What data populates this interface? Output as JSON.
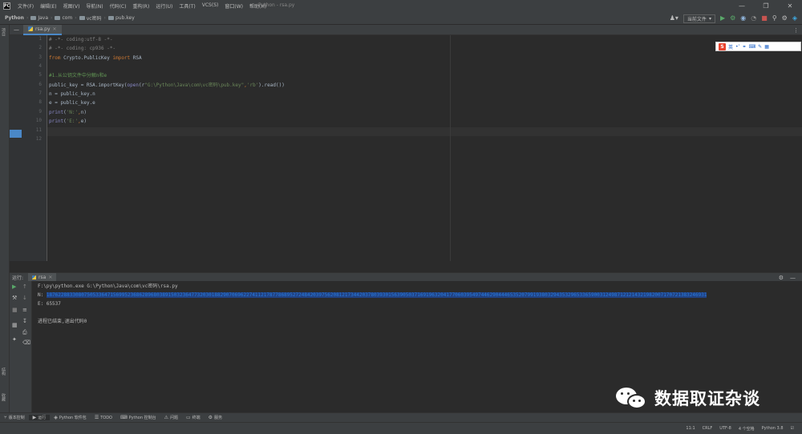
{
  "menu": {
    "logo": "PC",
    "items": [
      "文件(F)",
      "编辑(E)",
      "视图(V)",
      "导航(N)",
      "代码(C)",
      "重构(R)",
      "运行(U)",
      "工具(T)",
      "VCS(S)",
      "窗口(W)",
      "帮助(H)"
    ],
    "window_title": "Python - rsa.py"
  },
  "navbar": {
    "breadcrumbs": [
      "Python",
      "Java",
      "com",
      "vc密码",
      "pub.key"
    ],
    "run_config": "当前文件"
  },
  "left_strip": {
    "tabs": [
      "项目",
      "结构",
      "收藏"
    ]
  },
  "editor": {
    "tab_label": "rsa.py",
    "line_numbers": [
      "1",
      "2",
      "3",
      "4",
      "5",
      "6",
      "7",
      "8",
      "9",
      "10",
      "11",
      "12"
    ],
    "lines": [
      [
        {
          "t": "# -*- coding:utf-8 -*-",
          "c": "c-comment"
        }
      ],
      [
        {
          "t": "# -*- coding: cp936 -*-",
          "c": "c-comment"
        }
      ],
      [
        {
          "t": "from ",
          "c": "c-kw"
        },
        {
          "t": "Crypto.PublicKey ",
          "c": ""
        },
        {
          "t": "import ",
          "c": "c-kw"
        },
        {
          "t": "RSA",
          "c": ""
        }
      ],
      [],
      [
        {
          "t": "#1.从公钥文件中分解n和e",
          "c": "c-comment-cn"
        }
      ],
      [
        {
          "t": "public_key = RSA.importKey(",
          "c": ""
        },
        {
          "t": "open",
          "c": "c-builtin"
        },
        {
          "t": "(r",
          "c": ""
        },
        {
          "t": "\"G:\\Python\\Java\\com\\vc密码\\pub.key\"",
          "c": "c-str"
        },
        {
          "t": ",",
          "c": "c-kw"
        },
        {
          "t": "'rb'",
          "c": "c-str"
        },
        {
          "t": ").read())",
          "c": ""
        }
      ],
      [
        {
          "t": "n = public_key.n",
          "c": ""
        }
      ],
      [
        {
          "t": "e = public_key.e",
          "c": ""
        }
      ],
      [
        {
          "t": "print",
          "c": "c-builtin"
        },
        {
          "t": "(",
          "c": ""
        },
        {
          "t": "'N:'",
          "c": "c-str"
        },
        {
          "t": ",",
          "c": "c-kw"
        },
        {
          "t": "n)",
          "c": ""
        }
      ],
      [
        {
          "t": "print",
          "c": "c-builtin"
        },
        {
          "t": "(",
          "c": ""
        },
        {
          "t": "'E:'",
          "c": "c-str"
        },
        {
          "t": ",",
          "c": "c-kw"
        },
        {
          "t": "e)",
          "c": ""
        }
      ],
      [],
      []
    ]
  },
  "ime": {
    "logo": "S",
    "mode": "英"
  },
  "run_panel": {
    "label": "运行:",
    "tab": "rsa"
  },
  "console": {
    "command": "F:\\py\\python.exe G:\\Python\\Java\\com\\vc密码\\rsa.py",
    "n_prefix": "N: ",
    "n_value": "187622883308075053364715699523686289680389150323647732030188290706962274112178778689527248420397562081217344203780393015639050371691963204177060395497446290444653520799193803294353296533659003124987121214321982007170721383246931",
    "e_line": "E: 65537",
    "exit_line": "进程已结束,退出代码0"
  },
  "watermark": {
    "text": "数据取证杂谈"
  },
  "bottom_tools": [
    "版本控制",
    "运行",
    "Python 软件包",
    "TODO",
    "Python 控制台",
    "问题",
    "终端",
    "服务"
  ],
  "statusbar": {
    "position": "11:1",
    "line_sep": "CRLF",
    "encoding": "UTF-8",
    "indent": "4 个空格",
    "interpreter": "Python 3.8"
  }
}
